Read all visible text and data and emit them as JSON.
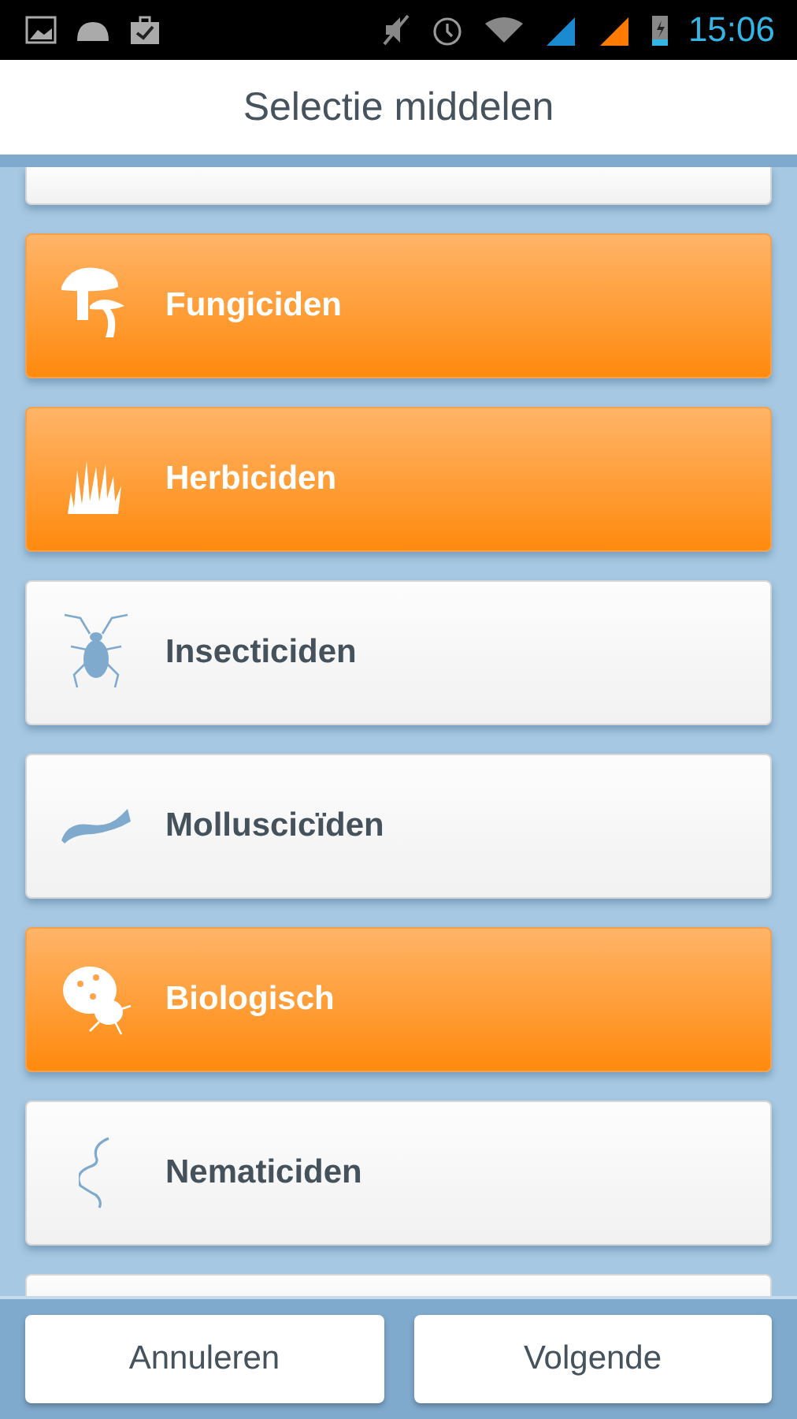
{
  "status_bar": {
    "time": "15:06"
  },
  "header": {
    "title": "Selectie middelen"
  },
  "items": [
    {
      "kind": "fungus",
      "label": "Fungiciden",
      "selected": true
    },
    {
      "kind": "grass",
      "label": "Herbiciden",
      "selected": true
    },
    {
      "kind": "insect",
      "label": "Insecticiden",
      "selected": false
    },
    {
      "kind": "slug",
      "label": "Molluscicïden",
      "selected": false
    },
    {
      "kind": "ladybug",
      "label": "Biologisch",
      "selected": true
    },
    {
      "kind": "nematode",
      "label": "Nematiciden",
      "selected": false
    }
  ],
  "buttons": [
    "Annuleren",
    "Volgende"
  ]
}
